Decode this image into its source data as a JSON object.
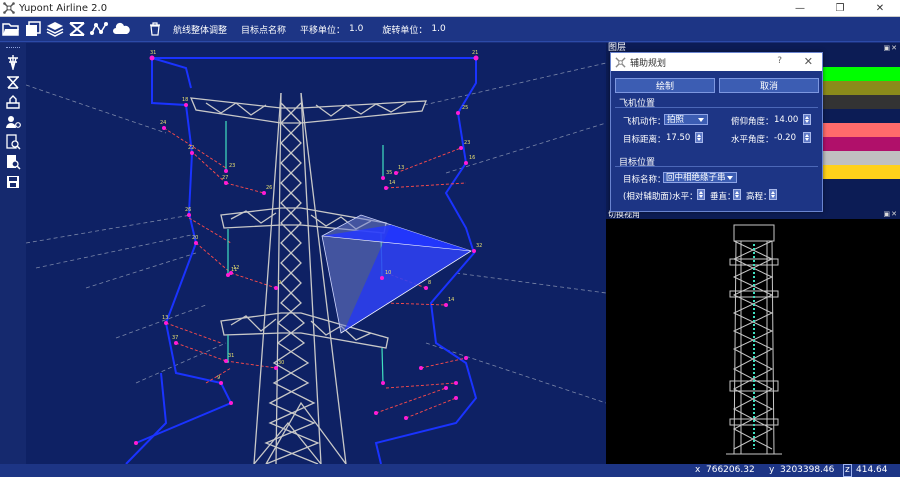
{
  "window": {
    "title": "Yupont Airline 2.0",
    "controls": [
      "—",
      "❐",
      "✕"
    ]
  },
  "toolbar": {
    "items": [
      {
        "name": "open-folder-icon"
      },
      {
        "name": "save-layers-icon"
      },
      {
        "name": "layers-icon"
      },
      {
        "name": "tower-icon"
      },
      {
        "name": "route-icon"
      },
      {
        "name": "cloud-icon"
      }
    ],
    "delete_icon": "trash-icon",
    "route_adjust_label": "航线整体调整",
    "target_name_label": "目标点名称",
    "translate_unit_label": "平移单位：",
    "translate_unit_value": "1.0",
    "rotate_unit_label": "旋转单位：",
    "rotate_unit_value": "1.0"
  },
  "leftbar": {
    "icons": [
      "tower-route-icon",
      "tower-cross-icon",
      "flight-plan-icon",
      "user-settings-icon",
      "search-doc-icon",
      "search-list-icon",
      "save-disk-icon"
    ]
  },
  "layers_panel": {
    "title": "图层",
    "colors": [
      "#0c1c55",
      "#00ff00",
      "#8b8b1a",
      "#333333",
      "#0c1c55",
      "#ff6b6b",
      "#b0106a",
      "#c0c0c0",
      "#ffd11a"
    ]
  },
  "view_panel": {
    "title": "切换视角"
  },
  "dialog": {
    "title": "辅助规划",
    "help": "?",
    "close": "✕",
    "draw_label": "绘制",
    "cancel_label": "取消",
    "aircraft_section": "飞机位置",
    "action_label": "飞机动作：",
    "action_value": "拍照",
    "pitch_label": "俯仰角度：",
    "pitch_value": "14.00",
    "distance_label": "目标距离：",
    "distance_value": "17.50",
    "yaw_label": "水平角度：",
    "yaw_value": "-0.20",
    "target_section": "目标位置",
    "target_name_label": "目标名称：",
    "target_name_value": "回中相绝缘子串",
    "relative_label": "(相对辅助面)水平：",
    "vertical_label": "垂直：",
    "elevation_label": "高程："
  },
  "statusbar": {
    "x_label": "x",
    "x_value": "766206.32",
    "y_label": "y",
    "y_value": "3203398.46",
    "z_label": "z",
    "z_value": "414.64"
  },
  "waypoints": {
    "labels": [
      "31",
      "21",
      "18",
      "24",
      "22",
      "23",
      "27",
      "26",
      "25",
      "23",
      "16",
      "35",
      "14",
      "13",
      "26",
      "20",
      "12",
      "11",
      "9",
      "10",
      "8",
      "14",
      "32",
      "13",
      "37",
      "31",
      "30",
      "9"
    ]
  }
}
